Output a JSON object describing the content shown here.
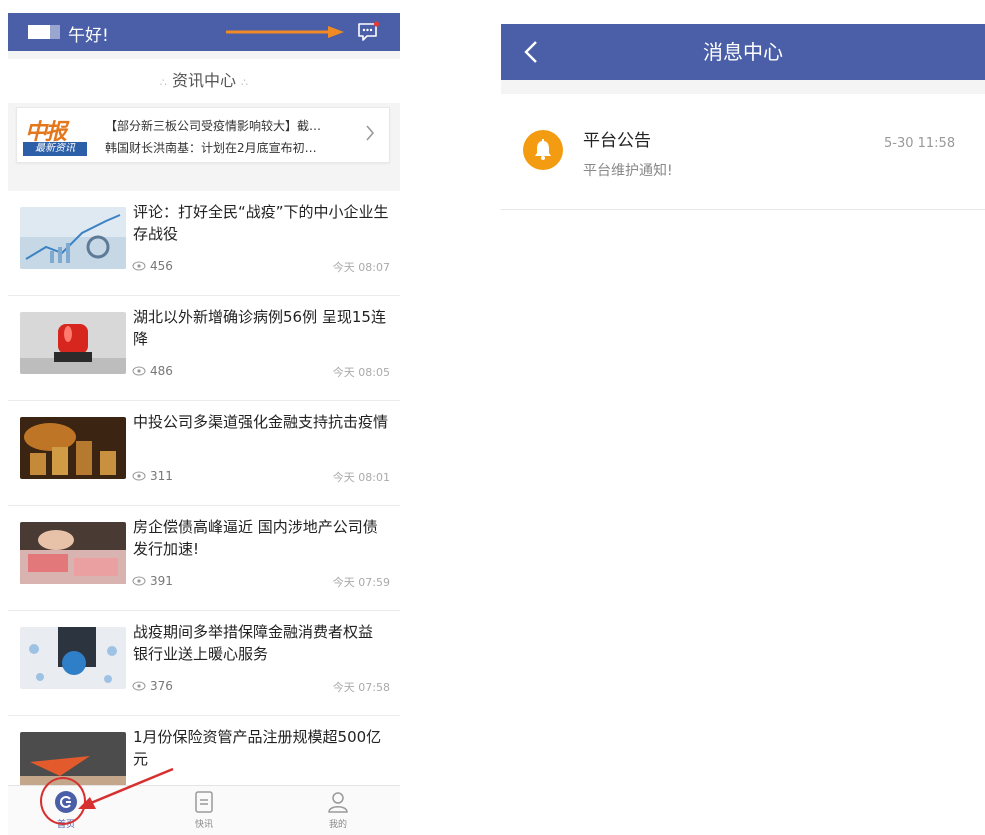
{
  "home": {
    "greeting": "午好!",
    "news_header": "资讯中心",
    "ticker": {
      "logo_main": "中报",
      "logo_sub": "最新资讯",
      "line1": "【部分新三板公司受疫情影响较大】截…",
      "line2": "韩国财长洪南基：计划在2月底宣布初…"
    },
    "news": [
      {
        "title": "评论：打好全民“战疫”下的中小企业生存战役",
        "views": "456",
        "time": "今天 08:07"
      },
      {
        "title": "湖北以外新增确诊病例56例 呈现15连降",
        "views": "486",
        "time": "今天 08:05"
      },
      {
        "title": "中投公司多渠道强化金融支持抗击疫情",
        "views": "311",
        "time": "今天 08:01"
      },
      {
        "title": "房企偿债高峰逼近 国内涉地产公司债发行加速!",
        "views": "391",
        "time": "今天 07:59"
      },
      {
        "title": "战疫期间多举措保障金融消费者权益 银行业送上暖心服务",
        "views": "376",
        "time": "今天 07:58"
      },
      {
        "title": "1月份保险资管产品注册规模超500亿元",
        "views": "",
        "time": ""
      }
    ],
    "nav": [
      {
        "label": "首页",
        "icon": "home-icon",
        "active": true
      },
      {
        "label": "快讯",
        "icon": "news-icon",
        "active": false
      },
      {
        "label": "我的",
        "icon": "user-icon",
        "active": false
      }
    ]
  },
  "messages": {
    "title": "消息中心",
    "items": [
      {
        "title": "平台公告",
        "subtitle": "平台维护通知!",
        "time": "5-30 11:58",
        "icon": "bell-icon"
      }
    ]
  },
  "colors": {
    "header_blue": "#4a5fa8",
    "annotation_red": "#d63031",
    "annotation_orange": "#f08a24",
    "bell_orange": "#f39c12"
  }
}
